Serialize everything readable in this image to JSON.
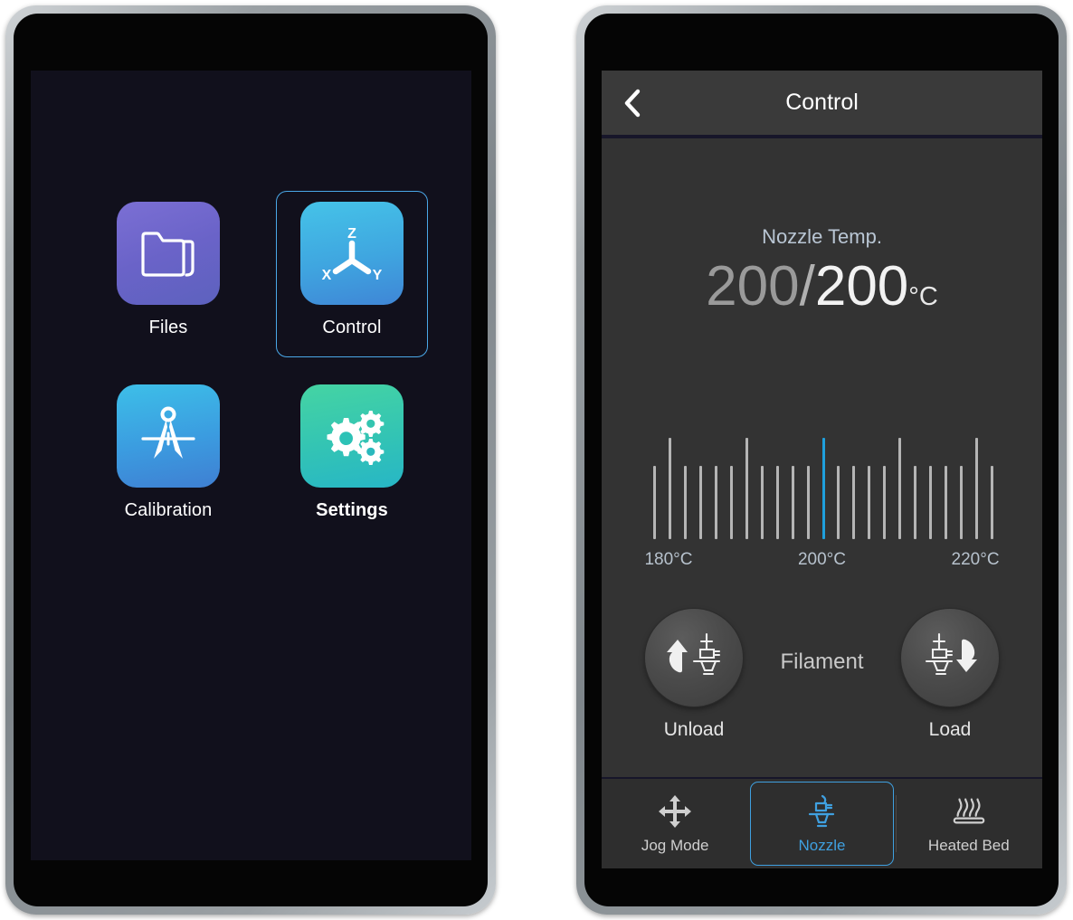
{
  "home": {
    "tiles": [
      {
        "id": "files",
        "label": "Files",
        "icon": "folder-icon",
        "selected": false
      },
      {
        "id": "control",
        "label": "Control",
        "icon": "xyz-axis-icon",
        "selected": true
      },
      {
        "id": "calibration",
        "label": "Calibration",
        "icon": "compass-icon",
        "selected": false
      },
      {
        "id": "settings",
        "label": "Settings",
        "icon": "gears-icon",
        "selected": false
      }
    ]
  },
  "control": {
    "header": {
      "back_icon": "chevron-left-icon",
      "title": "Control"
    },
    "nozzle": {
      "section_label": "Nozzle Temp.",
      "current": "200",
      "separator": "/",
      "target": "200",
      "unit": "°C"
    },
    "ruler": {
      "labels": [
        {
          "text": "180°C",
          "value": 180
        },
        {
          "text": "200°C",
          "value": 200
        },
        {
          "text": "220°C",
          "value": 220
        }
      ],
      "min": 178,
      "max": 222,
      "major_step": 10,
      "minor_step": 2,
      "active_value": 200,
      "active_color": "#1fa0dd",
      "tick_color": "#b5b5b5"
    },
    "filament": {
      "title": "Filament",
      "unload": {
        "label": "Unload",
        "icon": "filament-unload-icon"
      },
      "load": {
        "label": "Load",
        "icon": "filament-load-icon"
      }
    },
    "tabs": [
      {
        "id": "jog",
        "label": "Jog Mode",
        "icon": "move-arrows-icon",
        "active": false
      },
      {
        "id": "nozzle",
        "label": "Nozzle",
        "icon": "nozzle-icon",
        "active": true
      },
      {
        "id": "bed",
        "label": "Heated Bed",
        "icon": "heated-bed-icon",
        "active": false
      }
    ]
  },
  "colors": {
    "accent": "#3fa0e0",
    "screen_home_bg": "#11101c",
    "screen_control_bg": "#333333",
    "header_bg": "#3a3a3a",
    "tabbar_bg": "#2e2e2e"
  }
}
